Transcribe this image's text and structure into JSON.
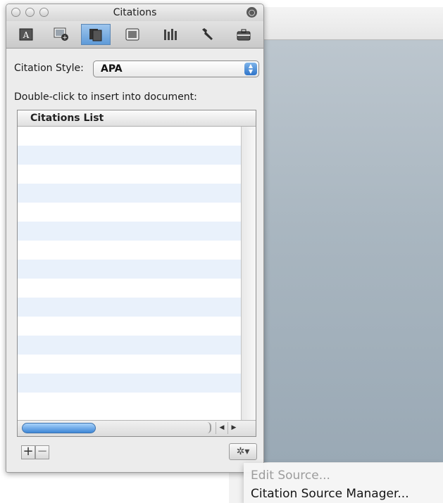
{
  "window": {
    "title": "Citations"
  },
  "toolbar": {
    "tools": [
      {
        "icon": "text-style-icon"
      },
      {
        "icon": "media-browser-icon"
      },
      {
        "icon": "citations-icon",
        "active": true
      },
      {
        "icon": "document-element-icon"
      },
      {
        "icon": "reference-tools-icon"
      },
      {
        "icon": "wrench-icon"
      },
      {
        "icon": "toolbox-icon"
      }
    ]
  },
  "style_selector": {
    "label": "Citation Style:",
    "value": "APA"
  },
  "instruction": "Double-click to insert into document:",
  "list": {
    "header": "Citations List",
    "row_count": 15
  },
  "footer": {
    "add_label": "+",
    "remove_label": "−",
    "gear_label": "✲▾"
  },
  "context_menu": {
    "items": [
      {
        "label": "Edit Source...",
        "enabled": false
      },
      {
        "label": "Citation Source Manager...",
        "enabled": true
      }
    ]
  },
  "colors": {
    "selection_blue": "#5f9bd8",
    "row_stripe": "#e9f1fb",
    "document_bg": "#a9b6c0"
  }
}
